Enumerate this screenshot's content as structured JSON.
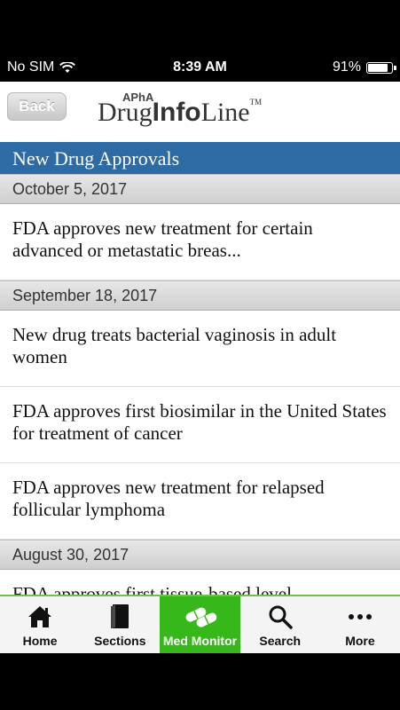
{
  "status_bar": {
    "carrier": "No SIM",
    "time": "8:39 AM",
    "battery": "91%",
    "battery_level": 0.91
  },
  "header": {
    "back_label": "Back",
    "logo": {
      "prefix": "APhA",
      "part1": "Drug",
      "part2": "Info",
      "part3": "Line",
      "tm": "TM"
    }
  },
  "section": {
    "title": "New Drug Approvals"
  },
  "feed": {
    "groups": [
      {
        "date": "October 5, 2017",
        "items": [
          "FDA approves new treatment for certain advanced or metastatic breas..."
        ]
      },
      {
        "date": "September 18, 2017",
        "items": [
          "New drug treats bacterial vaginosis in adult women",
          "FDA approves first biosimilar in the United States for treatment of cancer",
          "FDA approves new treatment for relapsed follicular lymphoma"
        ]
      },
      {
        "date": "August 30, 2017",
        "items": [
          "FDA approves first tissue-based level"
        ]
      }
    ]
  },
  "tabs": [
    {
      "label": "Home",
      "icon": "home-icon"
    },
    {
      "label": "Sections",
      "icon": "book-icon"
    },
    {
      "label": "Med Monitor",
      "icon": "pills-icon",
      "active": true
    },
    {
      "label": "Search",
      "icon": "search-icon"
    },
    {
      "label": "More",
      "icon": "more-icon"
    }
  ],
  "colors": {
    "section_bar": "#2e6aa4",
    "active_tab": "#36b81a"
  }
}
